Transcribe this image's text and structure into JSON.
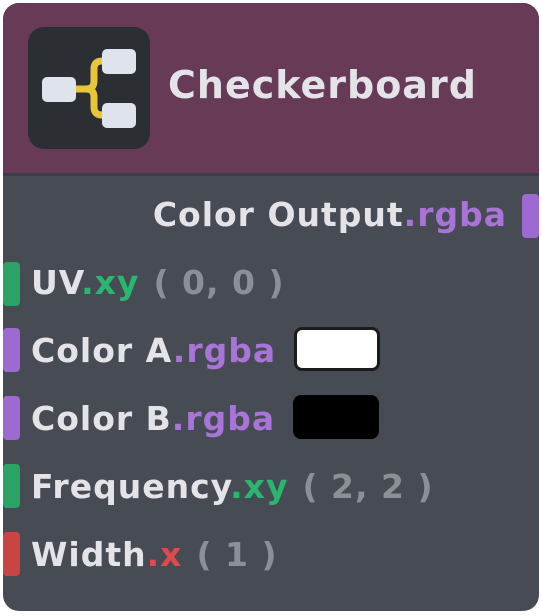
{
  "node": {
    "title": "Checkerboard",
    "icon": "node-branch-icon",
    "colors": {
      "header": "#673a56",
      "body": "#474c54",
      "rgba_swizzle": "#a874d8",
      "xy_swizzle": "#29b66e",
      "x_swizzle": "#e14a4a",
      "port_rgba": "#9c6ad0",
      "port_xy": "#2aa466",
      "port_x": "#c94545"
    }
  },
  "outputs": [
    {
      "label": "Color Output",
      "swizzle": ".rgba"
    }
  ],
  "inputs": [
    {
      "label": "UV",
      "swizzle": ".xy",
      "default": "( 0, 0 )"
    },
    {
      "label": "Color A",
      "swizzle": ".rgba",
      "swatch": "#ffffff"
    },
    {
      "label": "Color B",
      "swizzle": ".rgba",
      "swatch": "#000000"
    },
    {
      "label": "Frequency",
      "swizzle": ".xy",
      "default": "( 2, 2 )"
    },
    {
      "label": "Width",
      "swizzle": ".x",
      "default": "( 1 )"
    }
  ]
}
